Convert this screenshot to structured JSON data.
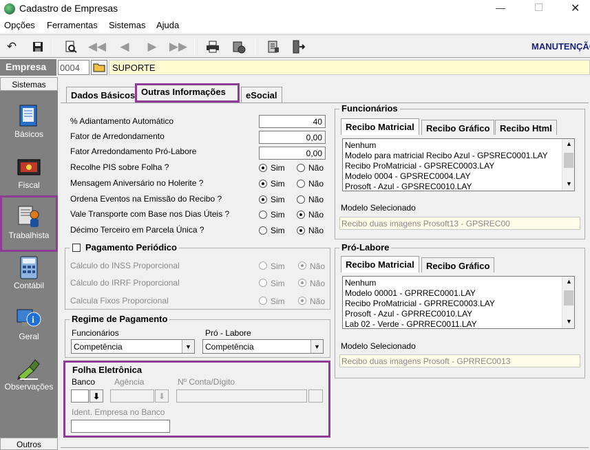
{
  "window": {
    "title": "Cadastro de Empresas",
    "minimize": "—",
    "maximize": "☐",
    "close": "✕"
  },
  "menu": [
    "Opções",
    "Ferramentas",
    "Sistemas",
    "Ajuda"
  ],
  "toolbar": {
    "mode_label": "MANUTENÇÃO"
  },
  "empresa": {
    "label": "Empresa",
    "code": "0004",
    "name": "SUPORTE"
  },
  "sidebar": {
    "header": "Sistemas",
    "items": [
      {
        "label": "Básicos",
        "icon": "book-icon"
      },
      {
        "label": "Fiscal",
        "icon": "fiscal-icon"
      },
      {
        "label": "Trabalhista",
        "icon": "worker-icon"
      },
      {
        "label": "Contábil",
        "icon": "calculator-icon"
      },
      {
        "label": "Geral",
        "icon": "info-icon"
      },
      {
        "label": "Observações",
        "icon": "pen-icon"
      }
    ],
    "footer": "Outros"
  },
  "tabs": [
    "Dados Básicos",
    "Outras Informações",
    "eSocial"
  ],
  "fields": {
    "adiantamento": {
      "label": "% Adiantamento Automático",
      "value": "40"
    },
    "arredondamento": {
      "label": "Fator de Arredondamento",
      "value": "0,00"
    },
    "arred_prolabore": {
      "label": "Fator Arredondamento Pró-Labore",
      "value": "0,00"
    }
  },
  "radios": [
    {
      "label": "Recolhe PIS sobre Folha ?",
      "value": "Sim"
    },
    {
      "label": "Mensagem Aniversário no Holerite ?",
      "value": "Sim"
    },
    {
      "label": "Ordena Eventos na Emissão do Recibo ?",
      "value": "Sim"
    },
    {
      "label": "Vale Transporte com Base nos Dias Úteis ?",
      "value": "Não"
    },
    {
      "label": "Décimo Terceiro em Parcela Única ?",
      "value": "Não"
    }
  ],
  "radio_yes": "Sim",
  "radio_no": "Não",
  "pagamento": {
    "title": "Pagamento Periódico",
    "checked": false,
    "rows": [
      {
        "label": "Cálculo do INSS Proporcional",
        "value": "Não"
      },
      {
        "label": "Cálculo do IRRF Proporcional",
        "value": "Não"
      },
      {
        "label": "Calcula Fixos Proporcional",
        "value": "Não"
      }
    ]
  },
  "regime": {
    "title": "Regime de Pagamento",
    "func_label": "Funcionários",
    "func_value": "Competência",
    "pro_label": "Pró - Labore",
    "pro_value": "Competência"
  },
  "folha": {
    "title": "Folha Eletrônica",
    "banco": "Banco",
    "agencia": "Agência",
    "conta": "Nº Conta/Dígito",
    "ident": "Ident. Empresa no Banco"
  },
  "funcionarios": {
    "title": "Funcionários",
    "tabs": [
      "Recibo Matricial",
      "Recibo Gráfico",
      "Recibo Html"
    ],
    "items": [
      "Nenhum",
      "Modelo para matricial Recibo Azul - GPSREC0001.LAY",
      "Recibo ProMatricial - GPSREC0003.LAY",
      "Modelo 0004 - GPSREC0004.LAY",
      "Prosoft - Azul - GPSREC0010.LAY"
    ],
    "sel_label": "Modelo Selecionado",
    "sel_value": "Recibo duas imagens Prosoft13 - GPSREC00"
  },
  "prolabore": {
    "title": "Pró-Labore",
    "tabs": [
      "Recibo Matricial",
      "Recibo Gráfico"
    ],
    "items": [
      "Nenhum",
      "Modelo 00001 - GPRREC0001.LAY",
      "Recibo ProMatricial - GPRREC0003.LAY",
      "Prosoft - Azul - GPRREC0010.LAY",
      "Lab 02 - Verde - GPRREC0011.LAY"
    ],
    "sel_label": "Modelo Selecionado",
    "sel_value": "Recibo duas imagens Prosoft - GPRREC0013"
  },
  "colors": {
    "highlight": "#8e3c96",
    "sidebar": "#808080",
    "empresa_bg": "#fffdd0"
  }
}
